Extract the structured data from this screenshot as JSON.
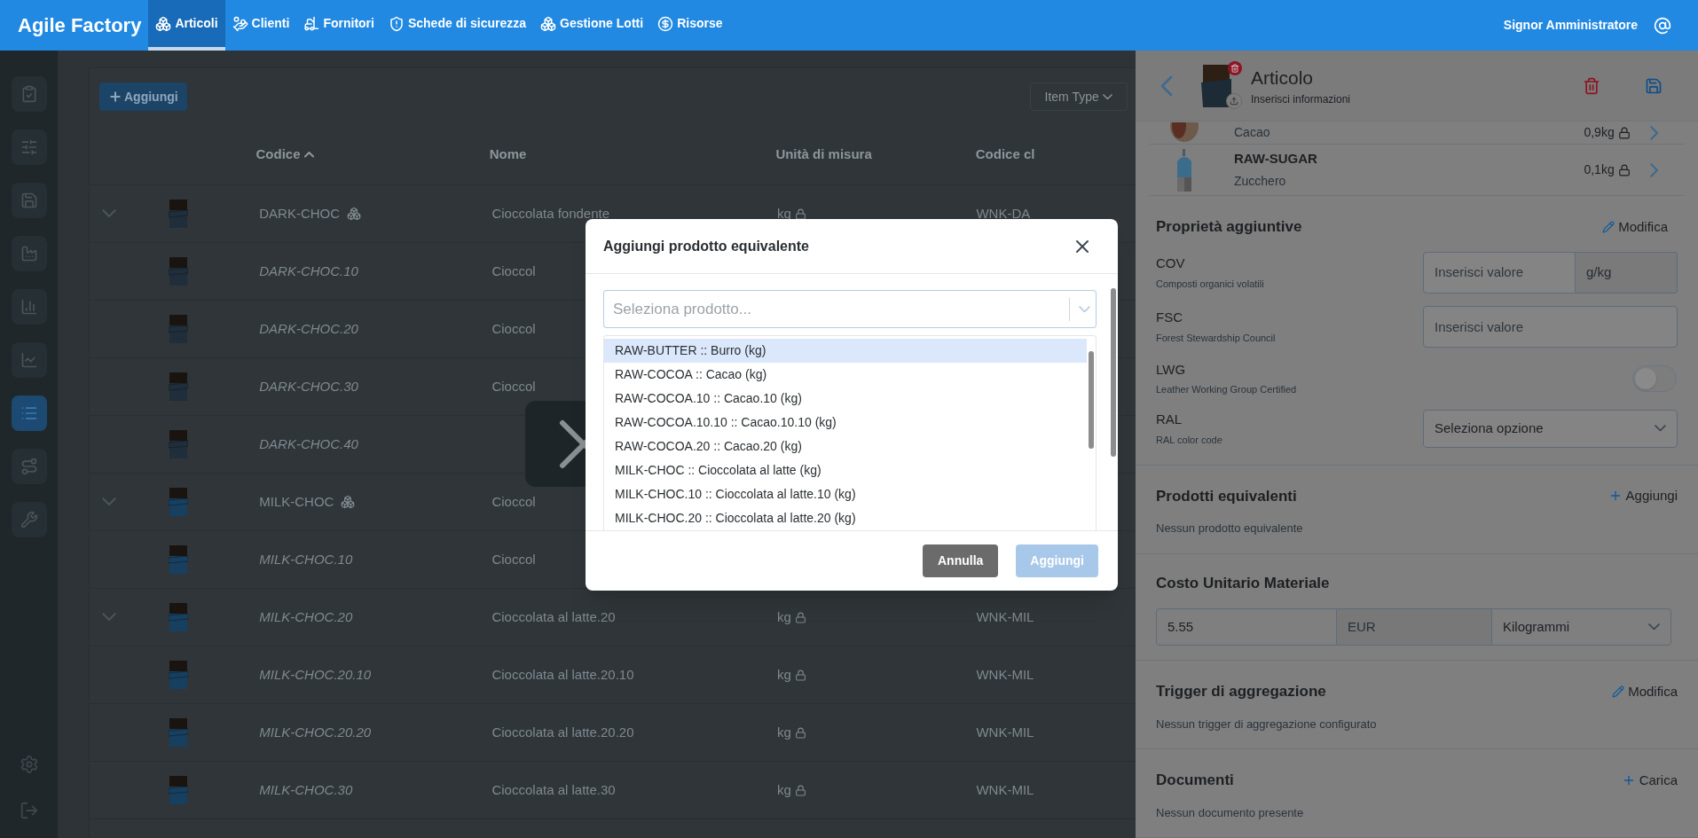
{
  "nav": {
    "brand": "Agile Factory",
    "items": [
      {
        "label": "Articoli",
        "selected": true
      },
      {
        "label": "Clienti",
        "selected": false
      },
      {
        "label": "Fornitori",
        "selected": false
      },
      {
        "label": "Schede di sicurezza",
        "selected": false
      },
      {
        "label": "Gestione Lotti",
        "selected": false
      },
      {
        "label": "Risorse",
        "selected": false
      }
    ],
    "user": "Signor Amministratore"
  },
  "sidebar": {
    "items": [
      {
        "selected": false
      },
      {
        "selected": false
      },
      {
        "selected": false
      },
      {
        "selected": false
      },
      {
        "selected": false
      },
      {
        "selected": false
      },
      {
        "selected": true
      },
      {
        "selected": false
      },
      {
        "selected": false
      }
    ]
  },
  "toolbar": {
    "add_button": "Aggiungi",
    "filter": "Item Type"
  },
  "table": {
    "columns": [
      {
        "label": "Codice",
        "sorted": true
      },
      {
        "label": "Nome",
        "sorted": false
      },
      {
        "label": "Unità di misura",
        "sorted": false
      },
      {
        "label": "Codice cl",
        "sorted": false
      }
    ],
    "rows": [
      {
        "code": "DARK-CHOC",
        "variant": false,
        "expandable": true,
        "bundle": true,
        "color": "#1f2e3a",
        "name": "Cioccolata fondente",
        "unit": "kg",
        "client_code": "WNK-DA"
      },
      {
        "code": "DARK-CHOC.10",
        "variant": true,
        "expandable": false,
        "bundle": false,
        "color": "#1f2e3a",
        "name": "Cioccol"
      },
      {
        "code": "DARK-CHOC.20",
        "variant": true,
        "expandable": false,
        "bundle": false,
        "color": "#1f2e3a",
        "name": "Cioccol"
      },
      {
        "code": "DARK-CHOC.30",
        "variant": true,
        "expandable": false,
        "bundle": false,
        "color": "#1f2e3a",
        "name": "Cioccol"
      },
      {
        "code": "DARK-CHOC.40",
        "variant": true,
        "expandable": false,
        "bundle": false,
        "color": "#1f2e3a"
      },
      {
        "code": "MILK-CHOC",
        "variant": false,
        "expandable": true,
        "bundle": true,
        "color": "#173f5f",
        "name": "Cioccol"
      },
      {
        "code": "MILK-CHOC.10",
        "variant": true,
        "expandable": false,
        "bundle": false,
        "color": "#173f5f",
        "name": "Cioccol"
      },
      {
        "code": "MILK-CHOC.20",
        "variant": true,
        "expandable": true,
        "bundle": false,
        "color": "#173f5f",
        "name": "Cioccolata al latte.20",
        "unit": "kg",
        "client_code": "WNK-MIL"
      },
      {
        "code": "MILK-CHOC.20.10",
        "variant": true,
        "expandable": false,
        "bundle": false,
        "color": "#173f5f",
        "name": "Cioccolata al latte.20.10",
        "unit": "kg",
        "client_code": "WNK-MIL"
      },
      {
        "code": "MILK-CHOC.20.20",
        "variant": true,
        "expandable": false,
        "bundle": false,
        "color": "#173f5f",
        "name": "Cioccolata al latte.20.20",
        "unit": "kg",
        "client_code": "WNK-MIL"
      },
      {
        "code": "MILK-CHOC.30",
        "variant": true,
        "expandable": false,
        "bundle": false,
        "color": "#173f5f",
        "name": "Cioccolata al latte.30",
        "unit": "kg",
        "client_code": "WNK-MIL"
      }
    ]
  },
  "modal": {
    "title": "Aggiungi prodotto equivalente",
    "select_placeholder": "Seleziona prodotto...",
    "options": [
      {
        "label": "RAW-BUTTER :: Burro (kg)",
        "selected": true
      },
      {
        "label": "RAW-COCOA :: Cacao (kg)",
        "selected": false
      },
      {
        "label": "RAW-COCOA.10 :: Cacao.10 (kg)",
        "selected": false
      },
      {
        "label": "RAW-COCOA.10.10 :: Cacao.10.10 (kg)",
        "selected": false
      },
      {
        "label": "RAW-COCOA.20 :: Cacao.20 (kg)",
        "selected": false
      },
      {
        "label": "MILK-CHOC :: Cioccolata al latte (kg)",
        "selected": false
      },
      {
        "label": "MILK-CHOC.10 :: Cioccolata al latte.10 (kg)",
        "selected": false
      },
      {
        "label": "MILK-CHOC.20 :: Cioccolata al latte.20 (kg)",
        "selected": false
      }
    ],
    "cancel": "Annulla",
    "confirm": {
      "label": "Aggiungi",
      "disabled": true
    }
  },
  "panel": {
    "title": "Articolo",
    "subtitle": "Inserisci informazioni",
    "components": [
      {
        "kind": "cocoa",
        "description": "Cacao",
        "qty": "0,9kg"
      },
      {
        "kind": "sugar",
        "name": "RAW-SUGAR",
        "description": "Zucchero",
        "qty": "0,1kg"
      }
    ],
    "properties": {
      "title": "Proprietà aggiuntive",
      "action": "Modifica",
      "items": [
        {
          "kind": "input_unit",
          "code": "COV",
          "description": "Composti organici volatili",
          "placeholder": "Inserisci valore",
          "unit": "g/kg"
        },
        {
          "kind": "input",
          "code": "FSC",
          "description": "Forest Stewardship Council",
          "placeholder": "Inserisci valore"
        },
        {
          "kind": "toggle",
          "code": "LWG",
          "description": "Leather Working Group Certified",
          "on": false
        },
        {
          "kind": "select",
          "code": "RAL",
          "description": "RAL color code",
          "value": "Seleziona opzione"
        }
      ]
    },
    "equivalents": {
      "title": "Prodotti equivalenti",
      "action": "Aggiungi",
      "empty": "Nessun prodotto equivalente"
    },
    "cost": {
      "title": "Costo Unitario Materiale",
      "value": "5.55",
      "currency": "EUR",
      "unit": "Kilogrammi"
    },
    "triggers": {
      "title": "Trigger di aggregazione",
      "action": "Modifica",
      "empty": "Nessun trigger di aggregazione configurato"
    },
    "documents": {
      "title": "Documenti",
      "action": "Carica",
      "empty": "Nessun documento presente"
    }
  }
}
